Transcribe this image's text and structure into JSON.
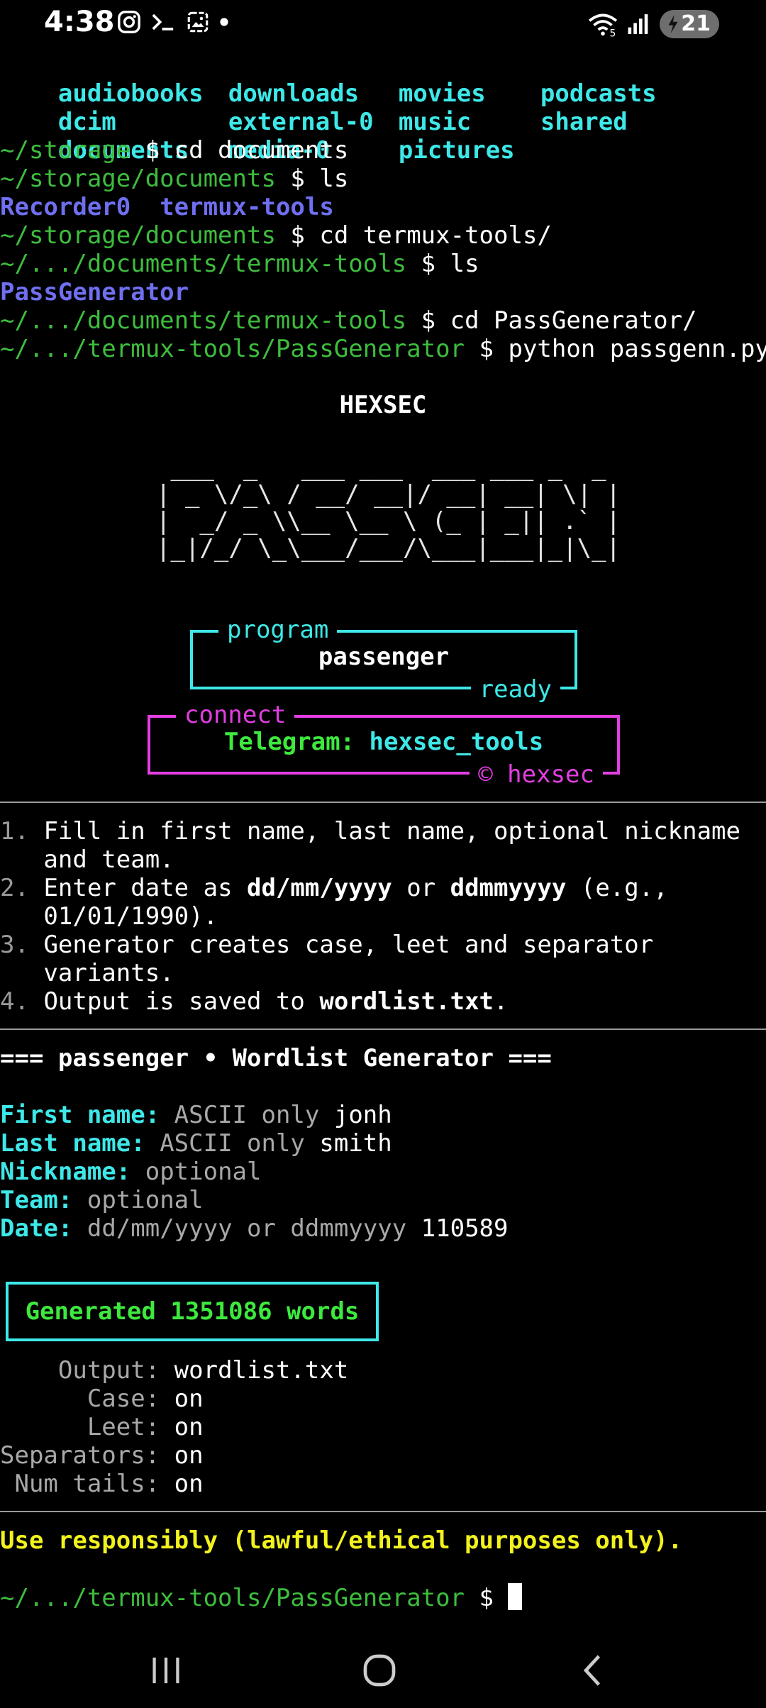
{
  "status": {
    "time": "4:38",
    "left_icons": [
      "instagram-icon",
      "terminal-icon",
      "gallery-icon",
      "dot-icon"
    ],
    "battery_level": "21",
    "wifi_badge": "5"
  },
  "terminal": {
    "ls1": [
      [
        "audiobooks",
        "downloads",
        "movies",
        "podcasts"
      ],
      [
        "dcim",
        "external-0",
        "music",
        "shared"
      ],
      [
        "documents",
        "media-0",
        "pictures",
        ""
      ]
    ],
    "prompts": [
      {
        "path": "~/storage",
        "cmd": "cd documents"
      },
      {
        "path": "~/storage/documents",
        "cmd": "ls"
      },
      {
        "path": "~/storage/documents",
        "cmd": "cd termux-tools/"
      },
      {
        "path": "~/.../documents/termux-tools",
        "cmd": "ls"
      },
      {
        "path": "~/.../documents/termux-tools",
        "cmd": "cd PassGenerator/"
      },
      {
        "path": "~/.../termux-tools/PassGenerator",
        "cmd": "python passgenn.py"
      }
    ],
    "dollar": "$",
    "ls2": [
      "Recorder0",
      "termux-tools"
    ],
    "ls3": [
      "PassGenerator"
    ],
    "brand": "HEXSEC",
    "ascii_art": [
      " ___  _   ___ ___  ___ ___ _  _ ",
      "| _ \\/_\\ / __/ __|/ __| __| \\| |",
      "|  _/ _ \\\\__ \\__ \\ (_ | _|| .` |",
      "|_|/_/ \\_\\___/___/\\___|___|_|\\_|"
    ],
    "program_box": {
      "top": "program",
      "content": "passenger",
      "bottom": "ready"
    },
    "connect_box": {
      "top": "connect",
      "label": "Telegram: ",
      "value": "hexsec_tools",
      "bottom": "© hexsec"
    },
    "steps": [
      {
        "n": "1.",
        "parts": [
          {
            "t": "Fill in first name, last name, optional nickname"
          }
        ],
        "cont": "and team."
      },
      {
        "n": "2.",
        "parts": [
          {
            "t": "Enter date as "
          },
          {
            "t": "dd/mm/yyyy",
            "b": true
          },
          {
            "t": " or "
          },
          {
            "t": "ddmmyyyy",
            "b": true
          },
          {
            "t": " (e.g.,"
          }
        ],
        "cont": "01/01/1990)."
      },
      {
        "n": "3.",
        "parts": [
          {
            "t": "Generator creates case, leet and separator"
          }
        ],
        "cont": "variants."
      },
      {
        "n": "4.",
        "parts": [
          {
            "t": "Output is saved to "
          },
          {
            "t": "wordlist.txt",
            "b": true
          },
          {
            "t": "."
          }
        ],
        "cont": ""
      }
    ],
    "header": "=== passenger • Wordlist Generator ===",
    "fields": [
      {
        "label": "First name:",
        "hint": "ASCII only",
        "value": "jonh"
      },
      {
        "label": "Last name:",
        "hint": "ASCII only",
        "value": "smith"
      },
      {
        "label": "Nickname:",
        "hint": "optional",
        "value": ""
      },
      {
        "label": "Team:",
        "hint": "optional",
        "value": ""
      },
      {
        "label": "Date:",
        "hint": "dd/mm/yyyy or ddmmyyyy",
        "value": "110589"
      }
    ],
    "generated": "Generated 1351086 words",
    "summary": [
      {
        "k": "    Output:",
        "v": "wordlist.txt"
      },
      {
        "k": "      Case:",
        "v": "on"
      },
      {
        "k": "      Leet:",
        "v": "on"
      },
      {
        "k": "Separators:",
        "v": "on"
      },
      {
        "k": " Num tails:",
        "v": "on"
      }
    ],
    "warning": "Use responsibly (lawful/ethical purposes only).",
    "final_prompt": "~/.../termux-tools/PassGenerator"
  },
  "navbar": {
    "items": [
      "recent-apps-icon",
      "home-icon",
      "back-icon"
    ]
  },
  "colors": {
    "cyan": "#3ee8e8",
    "green": "#3dbd3d",
    "blue": "#6f6ff0",
    "magenta": "#e23ee2",
    "yellow": "#f2f21e"
  }
}
